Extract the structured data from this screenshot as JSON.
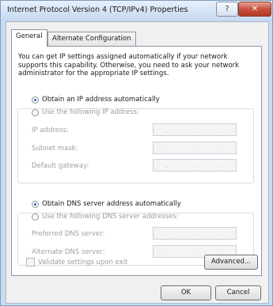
{
  "window": {
    "title": "Internet Protocol Version 4 (TCP/IPv4) Properties",
    "help_glyph": "?",
    "close_glyph": "✕"
  },
  "tabs": [
    {
      "label": "General",
      "active": true
    },
    {
      "label": "Alternate Configuration",
      "active": false
    }
  ],
  "description": "You can get IP settings assigned automatically if your network supports this capability. Otherwise, you need to ask your network administrator for the appropriate IP settings.",
  "ip": {
    "auto_label": "Obtain an IP address automatically",
    "manual_label": "Use the following IP address:",
    "selected": "auto",
    "fields": [
      {
        "label": "IP address:",
        "value": ""
      },
      {
        "label": "Subnet mask:",
        "value": ""
      },
      {
        "label": "Default gateway:",
        "value": ""
      }
    ]
  },
  "dns": {
    "auto_label": "Obtain DNS server address automatically",
    "manual_label": "Use the following DNS server addresses:",
    "selected": "auto",
    "fields": [
      {
        "label": "Preferred DNS server:",
        "value": ""
      },
      {
        "label": "Alternate DNS server:",
        "value": ""
      }
    ]
  },
  "validate_label": "Validate settings upon exit",
  "buttons": {
    "advanced": "Advanced...",
    "ok": "OK",
    "cancel": "Cancel"
  },
  "ip_separator": "."
}
